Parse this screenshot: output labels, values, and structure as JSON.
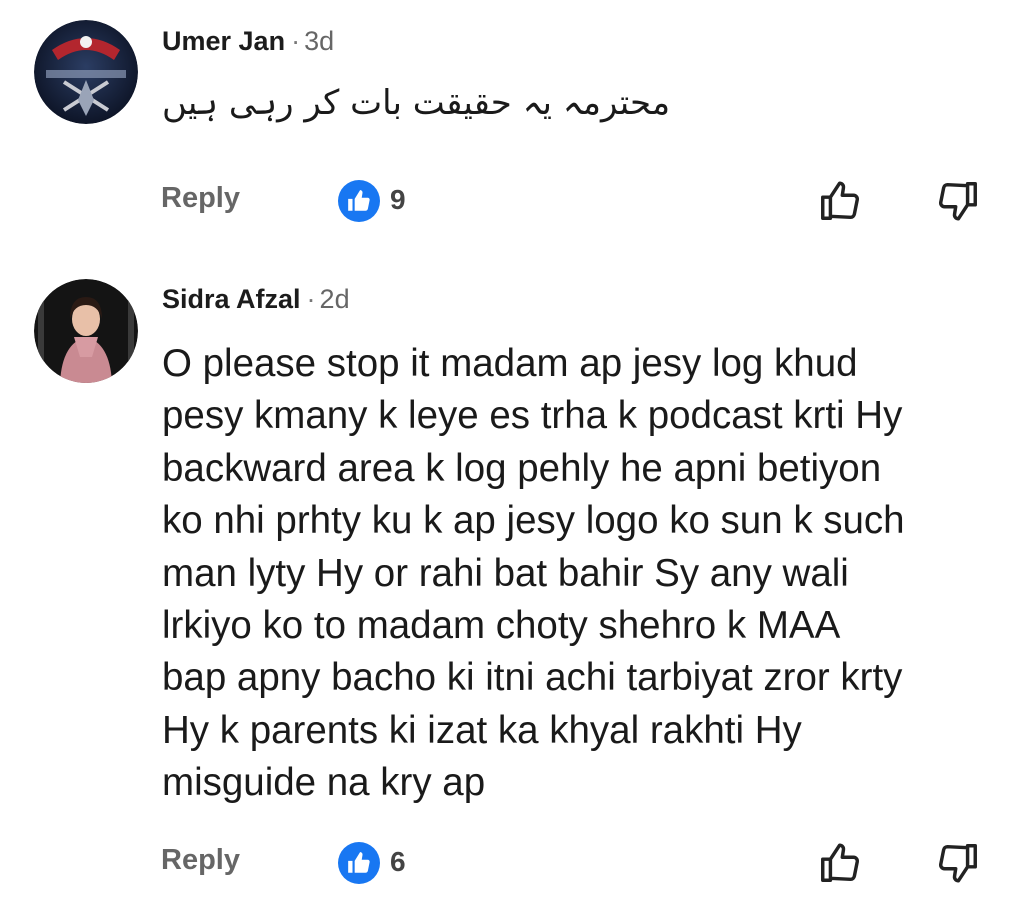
{
  "comments": [
    {
      "author": "Umer Jan",
      "separator": "·",
      "time": "3d",
      "text": "محترمہ یہ حقیقت بات کر رہی ہیں",
      "reply_label": "Reply",
      "like_count": "9",
      "avatar": "emblem-avatar"
    },
    {
      "author": "Sidra Afzal",
      "separator": "·",
      "time": "2d",
      "lines": [
        "O please stop it madam ap jesy log khud",
        "pesy kmany k leye es trha k podcast krti Hy",
        "backward area k log pehly he apni betiyon",
        "ko nhi prhty ku k ap jesy logo ko sun k such",
        "man lyty Hy or rahi bat bahir Sy any wali",
        "lrkiyo ko to madam choty shehro k MAA",
        "bap apny bacho ki itni achi tarbiyat zror krty",
        "Hy k parents ki izat ka khyal rakhti Hy",
        "misguide na kry ap"
      ],
      "reply_label": "Reply",
      "like_count": "6",
      "avatar": "woman-photo-avatar"
    }
  ],
  "icons": {
    "like_badge": "thumbs-up-badge-icon",
    "thumb_up": "thumbs-up-outline-icon",
    "thumb_down": "thumbs-down-outline-icon"
  },
  "colors": {
    "like_badge": "#1877f2",
    "secondary_text": "#666666",
    "primary_text": "#1c1c1c"
  }
}
